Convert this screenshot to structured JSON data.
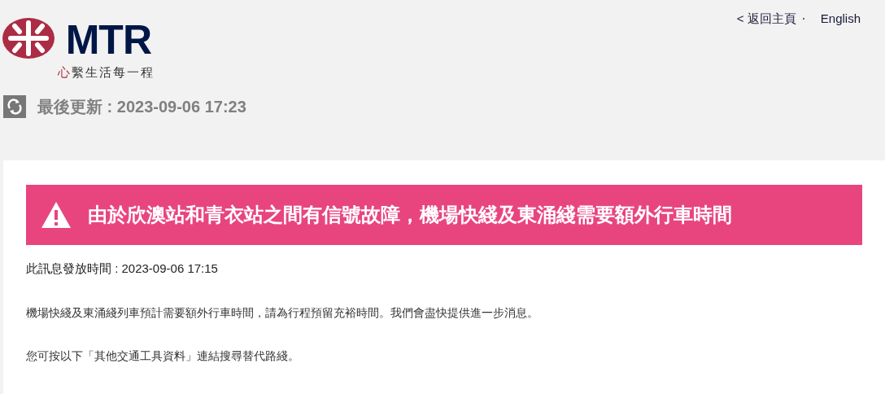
{
  "logo": {
    "wordmark": "MTR",
    "slogan_accent": "心",
    "slogan": "繫生活每一程"
  },
  "top_links": [
    {
      "label": "< 返回主頁"
    },
    {
      "label": "English"
    }
  ],
  "last_updated": "最後更新 : 2023-09-06 17:23",
  "alert": {
    "title": "由於欣澳站和青衣站之間有信號故障，機場快綫及東涌綫需要額外行車時間"
  },
  "issued": "此訊息發放時間 : 2023-09-06 17:15",
  "paragraphs": [
    "機場快綫及東涌綫列車預計需要額外行車時間，請為行程預留充裕時間。我們會盡快提供進一步消息。",
    "您可按以下「其他交通工具資料」連結搜尋替代路綫。"
  ]
}
